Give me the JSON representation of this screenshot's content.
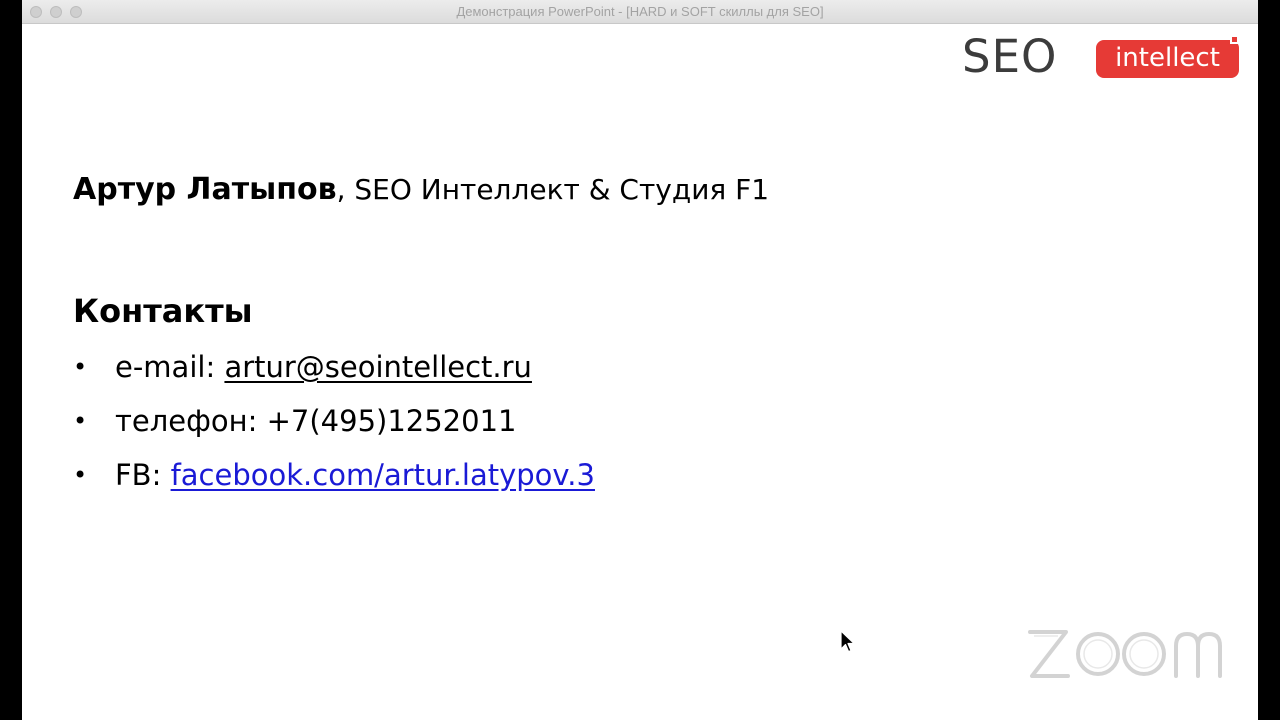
{
  "window": {
    "title": "Демонстрация PowerPoint - [HARD и SOFT скиллы для SEO]"
  },
  "logo": {
    "seo": "SEO",
    "intellect": "intellect",
    "accent_color": "#e63a36"
  },
  "slide": {
    "author_name": "Артур Латыпов",
    "author_org": ", SEO Интеллект & Студия F1",
    "contacts_heading": "Контакты",
    "contacts": [
      {
        "label": "e-mail: ",
        "value": "artur@seointellect.ru"
      },
      {
        "label": "телефон: +7(495)1252011",
        "value": ""
      },
      {
        "label": "FB: ",
        "value": "facebook.com/artur.latypov.3"
      }
    ],
    "bullet": "•"
  },
  "overlay": {
    "zoom_watermark": "zoom",
    "cursor_icon": "arrow-cursor-icon"
  }
}
